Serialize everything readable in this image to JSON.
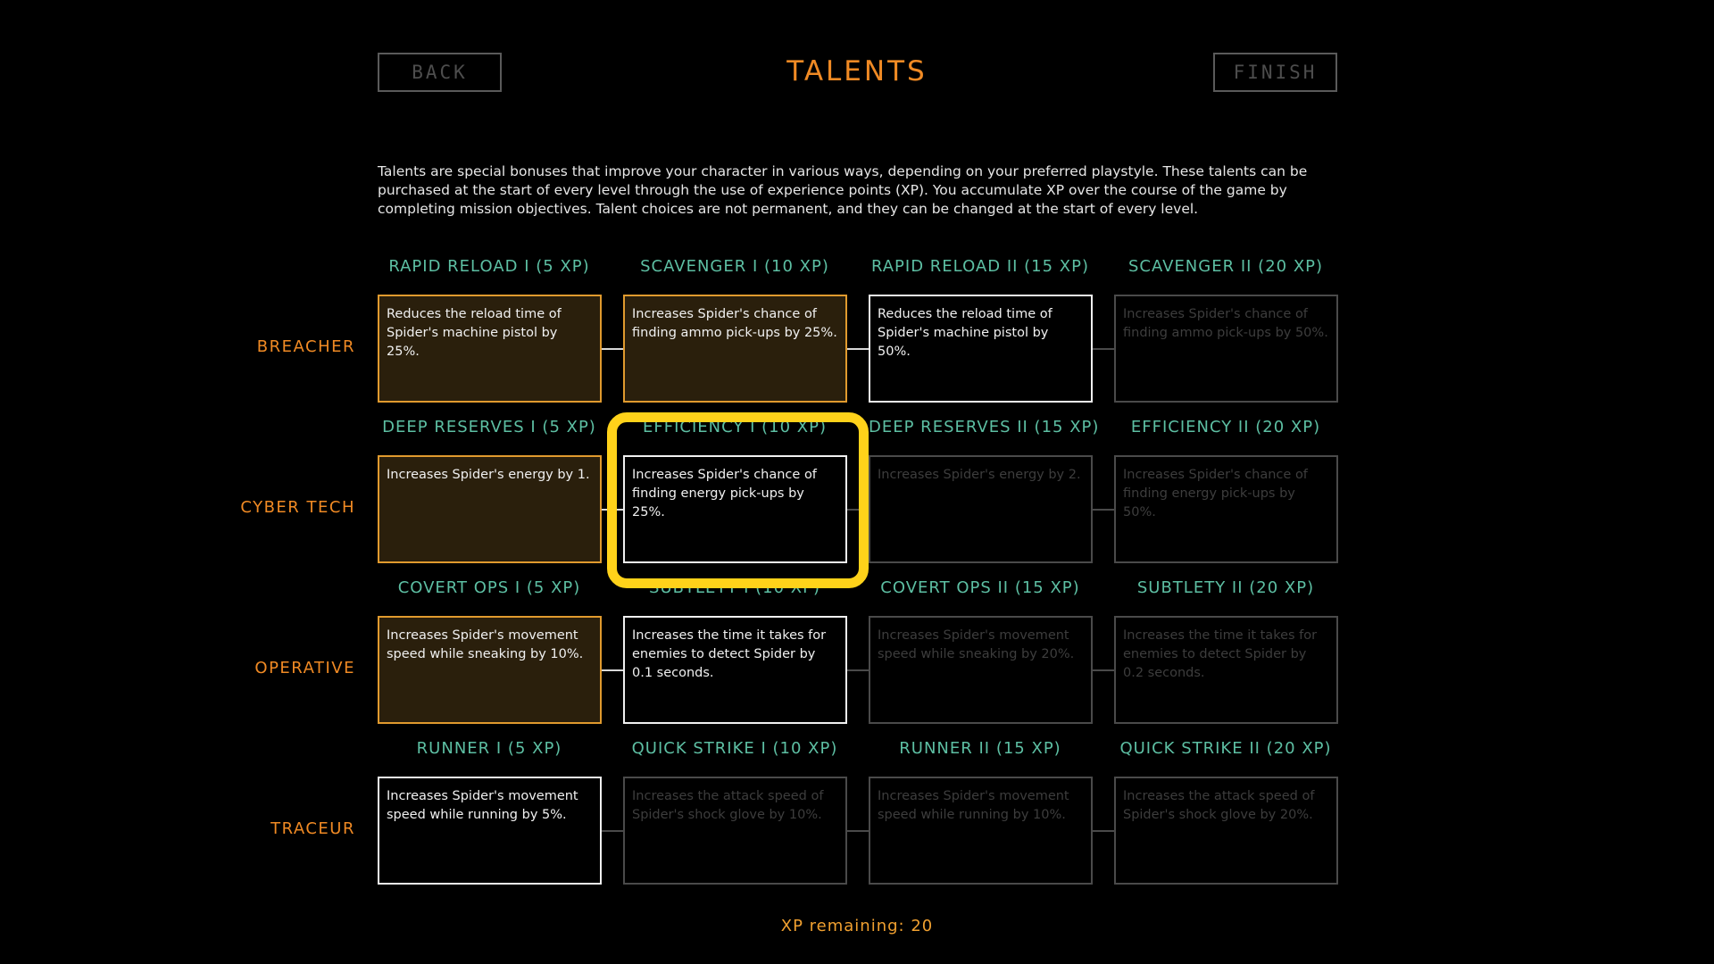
{
  "header": {
    "back_label": "BACK",
    "title": "TALENTS",
    "finish_label": "FINISH"
  },
  "intro": "Talents are special bonuses that improve your character in various ways, depending on your preferred playstyle. These talents can be purchased at the start of every level through the use of experience points (XP). You accumulate XP over the course of the game by completing mission objectives. Talent choices are not permanent, and they can be changed at the start of every level.",
  "rows": [
    {
      "label": "BREACHER",
      "talents": [
        {
          "name": "RAPID RELOAD I (5 XP)",
          "desc": "Reduces the reload time of Spider's machine pistol by 25%.",
          "state": "purchased"
        },
        {
          "name": "SCAVENGER I (10 XP)",
          "desc": "Increases Spider's chance of finding ammo pick-ups by 25%.",
          "state": "purchased"
        },
        {
          "name": "RAPID RELOAD II (15 XP)",
          "desc": "Reduces the reload time of Spider's machine pistol by 50%.",
          "state": "available"
        },
        {
          "name": "SCAVENGER II (20 XP)",
          "desc": "Increases Spider's chance of finding ammo pick-ups by 50%.",
          "state": "locked"
        }
      ]
    },
    {
      "label": "CYBER TECH",
      "talents": [
        {
          "name": "DEEP RESERVES I (5 XP)",
          "desc": "Increases Spider's energy by 1.",
          "state": "purchased"
        },
        {
          "name": "EFFICIENCY I (10 XP)",
          "desc": "Increases Spider's chance of finding energy pick-ups by 25%.",
          "state": "available"
        },
        {
          "name": "DEEP RESERVES II (15 XP)",
          "desc": "Increases Spider's energy by 2.",
          "state": "locked"
        },
        {
          "name": "EFFICIENCY II (20 XP)",
          "desc": "Increases Spider's chance of finding energy pick-ups by 50%.",
          "state": "locked"
        }
      ]
    },
    {
      "label": "OPERATIVE",
      "talents": [
        {
          "name": "COVERT OPS I (5 XP)",
          "desc": "Increases Spider's movement speed while sneaking by 10%.",
          "state": "purchased"
        },
        {
          "name": "SUBTLETY I (10 XP)",
          "desc": "Increases the time it takes for enemies to detect Spider by 0.1 seconds.",
          "state": "available"
        },
        {
          "name": "COVERT OPS II (15 XP)",
          "desc": "Increases Spider's movement speed while sneaking by 20%.",
          "state": "locked"
        },
        {
          "name": "SUBTLETY II (20 XP)",
          "desc": "Increases the time it takes for enemies to detect Spider by 0.2 seconds.",
          "state": "locked"
        }
      ]
    },
    {
      "label": "TRACEUR",
      "talents": [
        {
          "name": "RUNNER I (5 XP)",
          "desc": "Increases Spider's movement speed while running by 5%.",
          "state": "available"
        },
        {
          "name": "QUICK STRIKE I (10 XP)",
          "desc": "Increases the attack speed of Spider's shock glove by 10%.",
          "state": "locked"
        },
        {
          "name": "RUNNER II (15 XP)",
          "desc": "Increases Spider's movement speed while running by 10%.",
          "state": "locked"
        },
        {
          "name": "QUICK STRIKE II (20 XP)",
          "desc": "Increases the attack speed of Spider's shock glove by 20%.",
          "state": "locked"
        }
      ]
    }
  ],
  "footer": {
    "xp_remaining": "XP remaining: 20"
  },
  "colors": {
    "accent_orange": "#f08a24",
    "header_teal": "#5dbfa3",
    "highlight_yellow": "#ffd21a",
    "purchased_border": "#e09a2e"
  }
}
